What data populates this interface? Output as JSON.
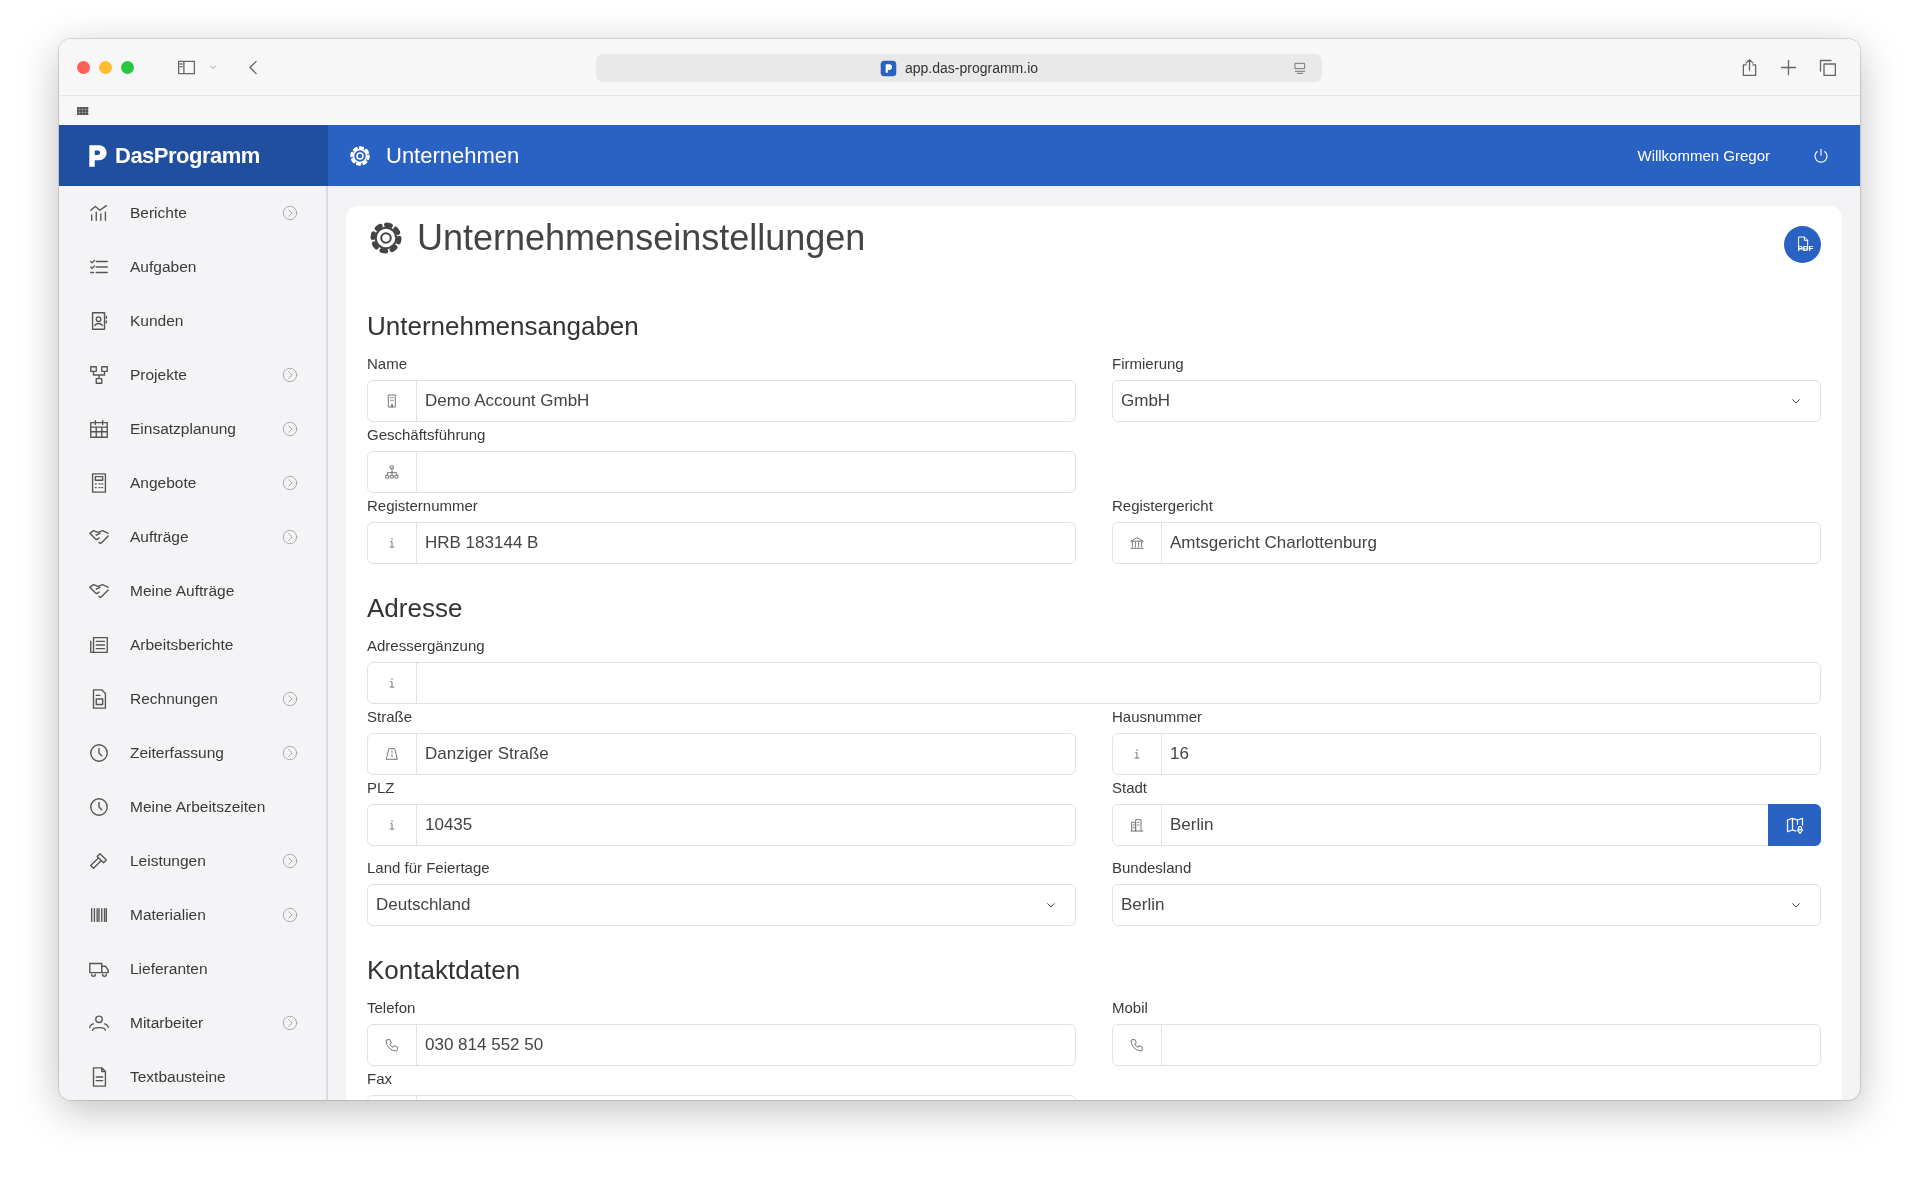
{
  "browser": {
    "url": "app.das-programm.io"
  },
  "app": {
    "logo": "DasProgramm",
    "page_title": "Unternehmen",
    "greeting": "Willkommen Gregor"
  },
  "sidebar": {
    "items": [
      {
        "label": "Berichte",
        "expandable": true
      },
      {
        "label": "Aufgaben",
        "expandable": false
      },
      {
        "label": "Kunden",
        "expandable": false
      },
      {
        "label": "Projekte",
        "expandable": true
      },
      {
        "label": "Einsatzplanung",
        "expandable": true
      },
      {
        "label": "Angebote",
        "expandable": true
      },
      {
        "label": "Aufträge",
        "expandable": true
      },
      {
        "label": "Meine Aufträge",
        "expandable": false
      },
      {
        "label": "Arbeitsberichte",
        "expandable": false
      },
      {
        "label": "Rechnungen",
        "expandable": true
      },
      {
        "label": "Zeiterfassung",
        "expandable": true
      },
      {
        "label": "Meine Arbeitszeiten",
        "expandable": false
      },
      {
        "label": "Leistungen",
        "expandable": true
      },
      {
        "label": "Materialien",
        "expandable": true
      },
      {
        "label": "Lieferanten",
        "expandable": false
      },
      {
        "label": "Mitarbeiter",
        "expandable": true
      },
      {
        "label": "Textbausteine",
        "expandable": false
      }
    ]
  },
  "content": {
    "title": "Unternehmenseinstellungen",
    "pdf_button": {
      "label": "PDF"
    },
    "sections": [
      {
        "heading": "Unternehmensangaben",
        "rows": [
          [
            {
              "label": "Name",
              "kind": "text",
              "value": "Demo Account GmbH"
            },
            {
              "label": "Firmierung",
              "kind": "select",
              "value": "GmbH"
            }
          ],
          [
            {
              "label": "Geschäftsführung",
              "kind": "text"
            }
          ],
          [
            {
              "label": "Registernummer",
              "kind": "text",
              "value": "HRB 183144 B"
            },
            {
              "label": "Registergericht",
              "kind": "text",
              "value": "Amtsgericht Charlottenburg"
            }
          ]
        ]
      },
      {
        "heading": "Adresse",
        "rows": [
          [
            {
              "label": "Adressergänzung",
              "kind": "text",
              "wide": true
            }
          ],
          [
            {
              "label": "Straße",
              "kind": "text",
              "value": "Danziger Straße"
            },
            {
              "label": "Hausnummer",
              "kind": "text",
              "value": "16"
            }
          ],
          [
            {
              "label": "PLZ",
              "kind": "text",
              "value": "10435"
            },
            {
              "label": "Stadt",
              "kind": "text_map",
              "value": "Berlin"
            }
          ],
          [
            {
              "label": "Land für Feiertage",
              "kind": "select",
              "value": "Deutschland"
            },
            {
              "label": "Bundesland",
              "kind": "select",
              "value": "Berlin"
            }
          ]
        ]
      },
      {
        "heading": "Kontaktdaten",
        "rows": [
          [
            {
              "label": "Telefon",
              "kind": "text",
              "value": "030 814 552 50"
            },
            {
              "label": "Mobil",
              "kind": "text"
            }
          ],
          [
            {
              "label": "Fax",
              "kind": "text"
            }
          ]
        ]
      }
    ]
  }
}
